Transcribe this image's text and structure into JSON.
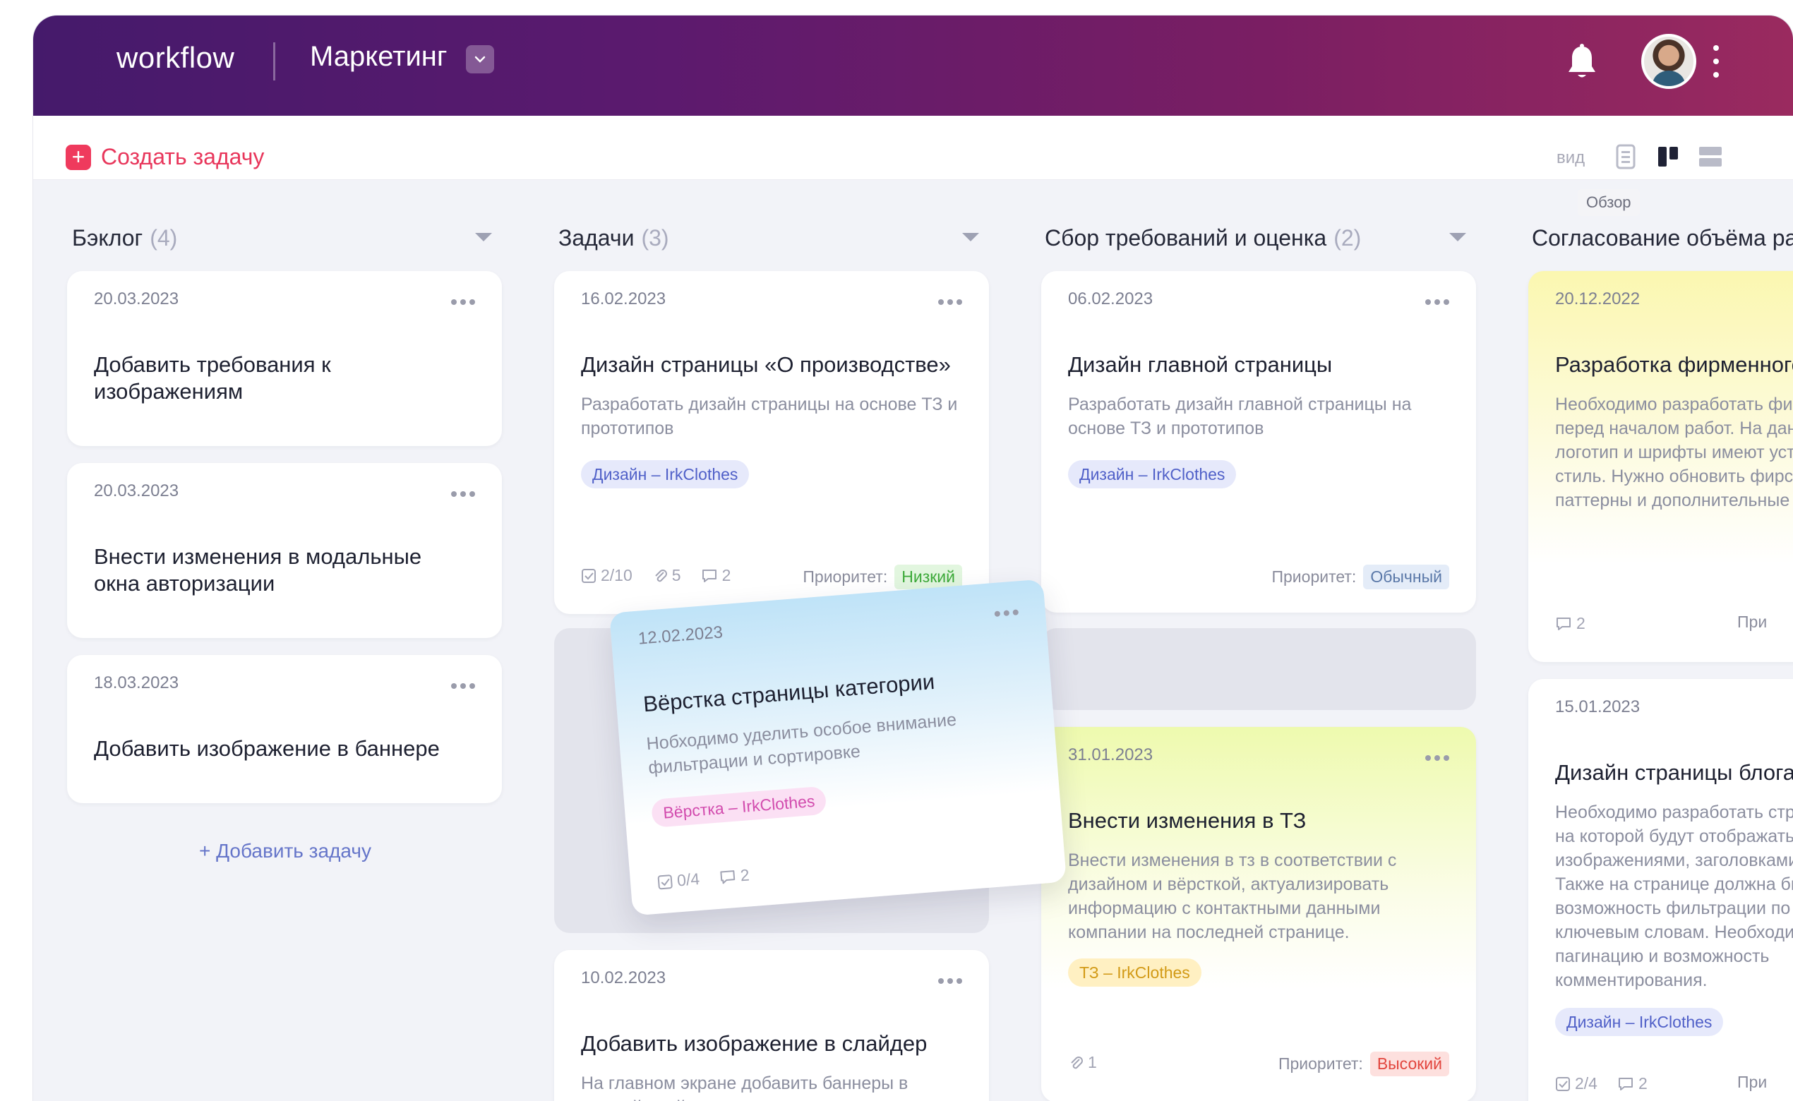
{
  "header": {
    "brand": "workflow",
    "project": "Маркетинг"
  },
  "toolbar": {
    "create_label": "Создать задачу",
    "view_label": "вид",
    "tooltip": "Обзор",
    "view_modes": [
      "list-icon",
      "board-icon",
      "rows-icon"
    ],
    "active_view": "board-icon"
  },
  "priority_label": "Приоритет:",
  "columns": [
    {
      "title": "Бэклог",
      "count": "(4)",
      "cards": [
        {
          "date": "20.03.2023",
          "title": "Добавить требования к изображениям"
        },
        {
          "date": "20.03.2023",
          "title": "Внести изменения в модальные окна авторизации"
        },
        {
          "date": "18.03.2023",
          "title": "Добавить изображение в баннере"
        }
      ],
      "add_label": "+ Добавить задачу"
    },
    {
      "title": "Задачи",
      "count": "(3)",
      "cards": [
        {
          "date": "16.02.2023",
          "title": "Дизайн страницы «О производстве»",
          "desc": "Разработать дизайн страницы на основе ТЗ и прототипов",
          "tag": "Дизайн – IrkClothes",
          "checklist": "2/10",
          "attachments": "5",
          "comments": "2",
          "priority": "Низкий"
        },
        {
          "date": "10.02.2023",
          "title": "Добавить изображение в слайдер",
          "desc": "На главном экране добавить баннеры в первый слайдер"
        }
      ]
    },
    {
      "title": "Сбор требований и оценка",
      "count": "(2)",
      "cards": [
        {
          "date": "06.02.2023",
          "title": "Дизайн главной страницы",
          "desc": "Разработать дизайн главной страницы на основе ТЗ и прототипов",
          "tag": "Дизайн – IrkClothes",
          "priority": "Обычный"
        },
        {
          "date": "31.01.2023",
          "title": "Внести изменения в ТЗ",
          "desc": "Внести изменения в тз в соответствии с дизайном и вёрсткой, актуализировать информацию с контактными данными компании на последней странице.",
          "tag": "ТЗ – IrkClothes",
          "attachments": "1",
          "priority": "Высокий"
        }
      ]
    },
    {
      "title": "Согласование объёма работ",
      "cards": [
        {
          "date": "20.12.2022",
          "title": "Разработка фирменного стиля",
          "desc": "Необходимо разработать фирменный стиль перед началом работ. На данный момент логотип и шрифты имеют устаревший стиль. Нужно обновить фирстиль, добавить паттерны и дополнительные цвета.",
          "comments": "2",
          "priority_short": "При"
        },
        {
          "date": "15.01.2023",
          "title": "Дизайн страницы блога",
          "desc": "Необходимо разработать страницу блога, на которой будут отображаться статьи с изображениями, заголовками и описанием. Также на странице должна быть возможность фильтрации по категориям и ключевым словам. Необходимо добавить пагинацию и возможность комментирования.",
          "tag": "Дизайн – IrkClothes",
          "checklist": "2/4",
          "comments": "2",
          "priority_short": "При"
        }
      ]
    }
  ],
  "dragged_card": {
    "date": "12.02.2023",
    "title": "Вёрстка страницы категории",
    "desc": "Нобходимо уделить особое внимание фильтрации и сортировке",
    "tag": "Вёрстка – IrkClothes",
    "checklist": "0/4",
    "comments": "2"
  },
  "colors": {
    "header_gradient": [
      "#451a6b",
      "#9a2a5f"
    ],
    "accent": "#ef3a5d",
    "board_bg": "#f2f3f8"
  }
}
